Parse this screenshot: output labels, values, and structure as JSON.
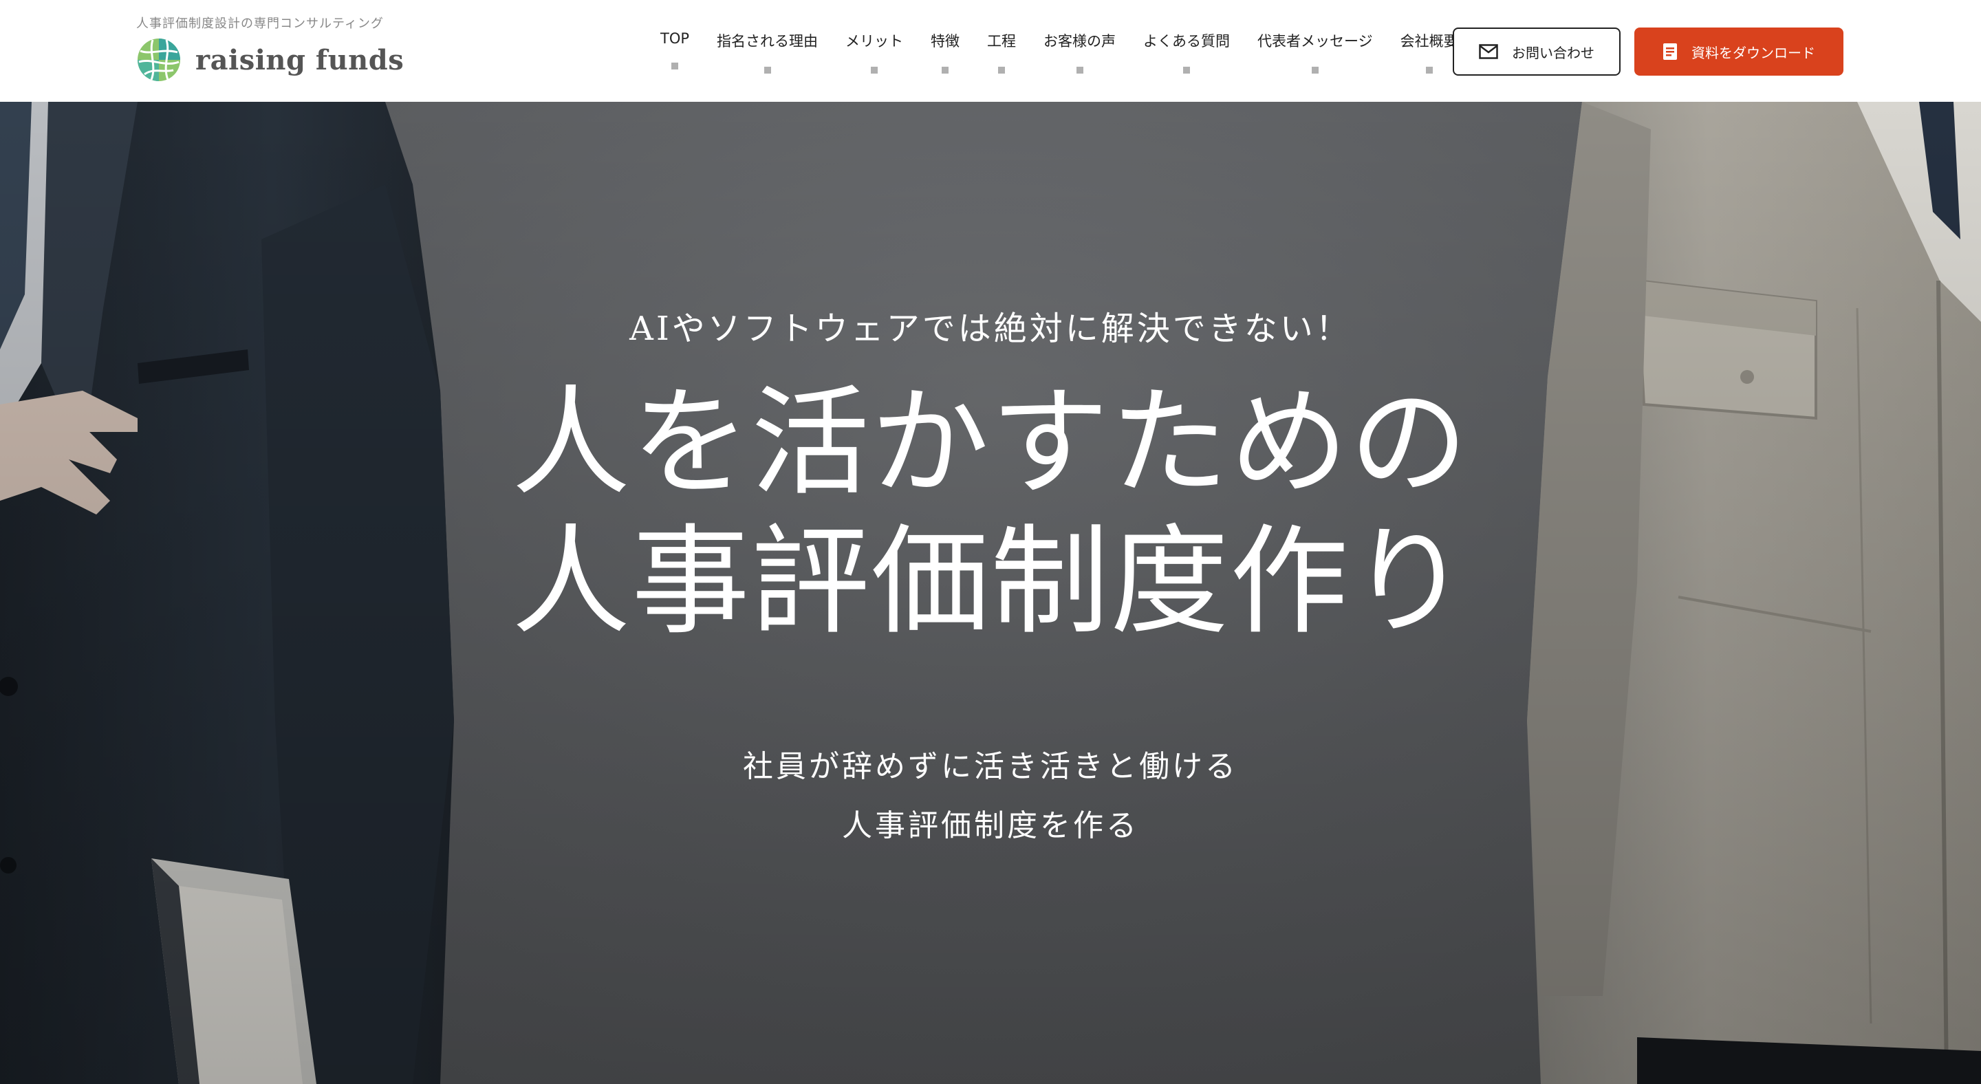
{
  "header": {
    "tagline": "人事評価制度設計の専門コンサルティング",
    "logo_text": "raising funds",
    "nav": [
      {
        "label": "TOP"
      },
      {
        "label": "指名される理由"
      },
      {
        "label": "メリット"
      },
      {
        "label": "特徴"
      },
      {
        "label": "工程"
      },
      {
        "label": "お客様の声"
      },
      {
        "label": "よくある質問"
      },
      {
        "label": "代表者メッセージ"
      },
      {
        "label": "会社概要"
      }
    ],
    "contact_label": "お問い合わせ",
    "download_label": "資料をダウンロード"
  },
  "hero": {
    "eyebrow": "AIやソフトウェアでは絶対に解決できない！",
    "headline_line1": "人を活かすための",
    "headline_line2": "人事評価制度作り",
    "sub_line1": "社員が辞めずに活き活きと働ける",
    "sub_line2": "人事評価制度を作る"
  },
  "colors": {
    "accent": "#d9421d",
    "logo_teal": "#3aa59b",
    "logo_green": "#8cc66b",
    "hero_overlay": "#5f6164"
  },
  "icons": {
    "logo": "globe-leaf-logo-icon",
    "contact": "envelope-icon",
    "download": "document-icon"
  }
}
